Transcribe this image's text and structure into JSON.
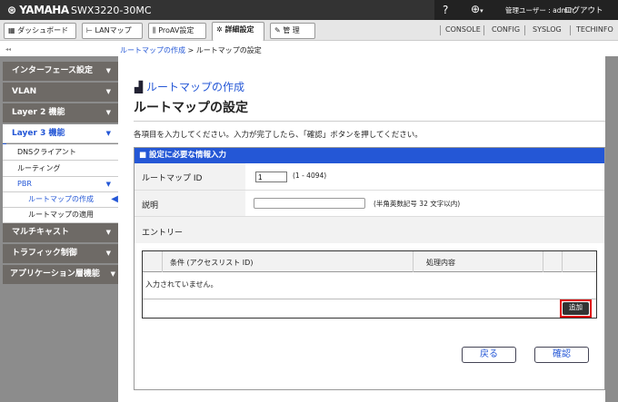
{
  "header": {
    "logo": "YAMAHA",
    "model": "SWX3220-30MC",
    "help": "?",
    "user": "管理ユーザー : admin",
    "logout": "ログアウト"
  },
  "toolbar": {
    "tabs": [
      "ダッシュボード",
      "LANマップ",
      "ProAV設定",
      "詳細設定",
      "管 理"
    ],
    "links": [
      "CONSOLE",
      "CONFIG",
      "SYSLOG",
      "TECHINFO"
    ]
  },
  "breadcrumb": {
    "collapse": "◂◂",
    "parent": "ルートマップの作成",
    "separator": ">",
    "current": "ルートマップの設定"
  },
  "sidebar": {
    "items": [
      "インターフェース設定",
      "VLAN",
      "Layer 2 機能",
      "Layer 3 機能",
      "マルチキャスト",
      "トラフィック制御",
      "アプリケーション層機能"
    ],
    "sub": [
      "DNSクライアント",
      "ルーティング",
      "PBR"
    ],
    "pbr_sub": [
      "ルートマップの作成",
      "ルートマップの適用"
    ]
  },
  "main": {
    "section_title": "ルートマップの作成",
    "page_title": "ルートマップの設定",
    "instruction": "各項目を入力してください。入力が完了したら、「確認」ボタンを押してください。",
    "panel_header": "■ 設定に必要な情報入力",
    "fields": {
      "id_label": "ルートマップ ID",
      "id_value": "1",
      "id_hint": "(1 - 4094)",
      "desc_label": "説明",
      "desc_value": "",
      "desc_hint": "(半角英数記号 32 文字以内)",
      "entry_label": "エントリー"
    },
    "table": {
      "columns": [
        "条件 (アクセスリスト ID)",
        "処理内容"
      ],
      "empty": "入力されていません。",
      "add": "追加"
    },
    "back": "戻る",
    "confirm": "確認"
  }
}
